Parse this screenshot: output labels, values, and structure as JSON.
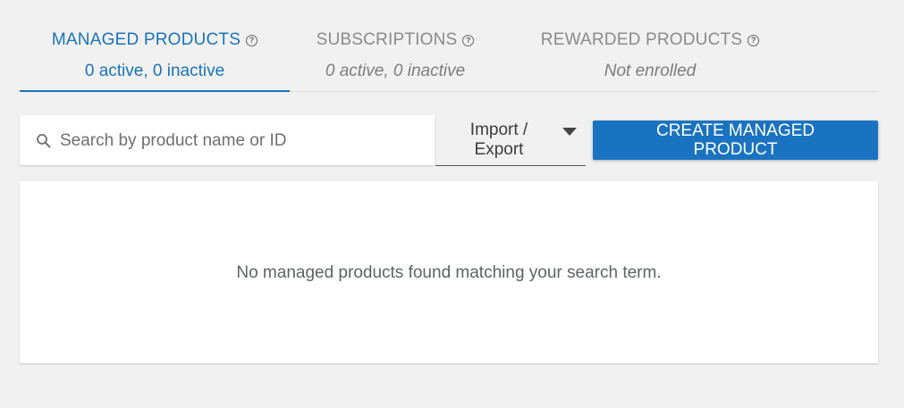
{
  "tabs": [
    {
      "title": "MANAGED PRODUCTS",
      "subtitle": "0 active, 0 inactive",
      "active": true
    },
    {
      "title": "SUBSCRIPTIONS",
      "subtitle": "0 active, 0 inactive",
      "active": false
    },
    {
      "title": "REWARDED PRODUCTS",
      "subtitle": "Not enrolled",
      "active": false
    }
  ],
  "help_glyph": "?",
  "search": {
    "placeholder": "Search by product name or ID",
    "value": "",
    "icon": "search-icon"
  },
  "import_export": {
    "label": "Import /\nExport",
    "icon": "caret-down-icon"
  },
  "create_button": {
    "label": "CREATE MANAGED PRODUCT"
  },
  "empty_state": {
    "message": "No managed products found matching your search term."
  },
  "colors": {
    "accent": "#1a73b8",
    "button": "#1a73c0",
    "background": "#f1f1f1"
  }
}
